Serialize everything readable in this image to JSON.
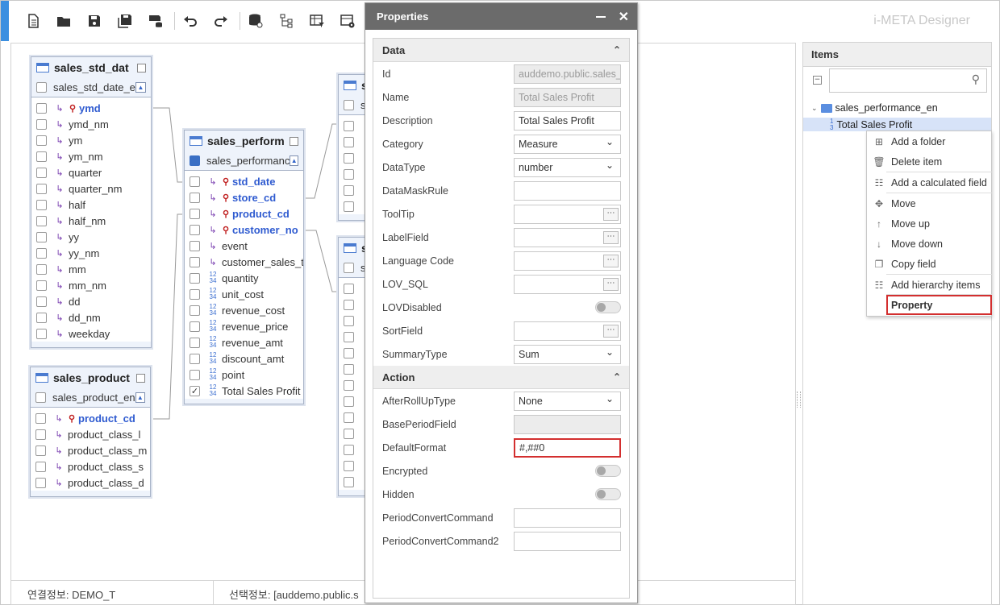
{
  "app_title": "i-META Designer",
  "toolbar_icons": [
    "new-document-icon",
    "open-folder-icon",
    "save-icon",
    "save-all-icon",
    "save-db-icon",
    "undo-icon",
    "redo-icon",
    "database-link-icon",
    "hierarchy-icon",
    "table-filter-icon",
    "table-settings-icon"
  ],
  "tables": {
    "t1": {
      "title": "sales_std_dat",
      "subtitle": "sales_std_date_e",
      "rows": [
        "ymd",
        "ymd_nm",
        "ym",
        "ym_nm",
        "quarter",
        "quarter_nm",
        "half",
        "half_nm",
        "yy",
        "yy_nm",
        "mm",
        "mm_nm",
        "dd",
        "dd_nm",
        "weekday"
      ]
    },
    "t2": {
      "title": "sales_product",
      "subtitle": "sales_product_en",
      "rows": [
        "product_cd",
        "product_class_l",
        "product_class_m",
        "product_class_s",
        "product_class_d"
      ]
    },
    "t3": {
      "title": "sales_perform",
      "subtitle": "sales_performanc",
      "rows": [
        "std_date",
        "store_cd",
        "product_cd",
        "customer_no",
        "event",
        "customer_sales_ti",
        "quantity",
        "unit_cost",
        "revenue_cost",
        "revenue_price",
        "revenue_amt",
        "discount_amt",
        "point",
        "Total Sales Profit"
      ]
    },
    "t4": {
      "title": "s",
      "subtitle": "s"
    },
    "t5": {
      "title": "s",
      "subtitle": "s"
    }
  },
  "status": {
    "conn": "연결정보: DEMO_T",
    "sel": "선택정보: [auddemo.public.s"
  },
  "props": {
    "title": "Properties",
    "data_section": "Data",
    "action_section": "Action",
    "data_rows": [
      {
        "label": "Id",
        "value": "auddemo.public.sales_",
        "kind": "disabled"
      },
      {
        "label": "Name",
        "value": "Total Sales Profit",
        "kind": "disabled"
      },
      {
        "label": "Description",
        "value": "Total Sales Profit",
        "kind": "text"
      },
      {
        "label": "Category",
        "value": "Measure",
        "kind": "select"
      },
      {
        "label": "DataType",
        "value": "number",
        "kind": "select"
      },
      {
        "label": "DataMaskRule",
        "value": "",
        "kind": "text"
      },
      {
        "label": "ToolTip",
        "value": "",
        "kind": "dots"
      },
      {
        "label": "LabelField",
        "value": "",
        "kind": "dots"
      },
      {
        "label": "Language Code",
        "value": "",
        "kind": "dots"
      },
      {
        "label": "LOV_SQL",
        "value": "",
        "kind": "dots"
      },
      {
        "label": "LOVDisabled",
        "value": "",
        "kind": "toggle"
      },
      {
        "label": "SortField",
        "value": "",
        "kind": "dots"
      },
      {
        "label": "SummaryType",
        "value": "Sum",
        "kind": "select"
      }
    ],
    "action_rows": [
      {
        "label": "AfterRollUpType",
        "value": "None",
        "kind": "select"
      },
      {
        "label": "BasePeriodField",
        "value": "",
        "kind": "disabled"
      },
      {
        "label": "DefaultFormat",
        "value": "#,##0",
        "kind": "highlight"
      },
      {
        "label": "Encrypted",
        "value": "",
        "kind": "toggle"
      },
      {
        "label": "Hidden",
        "value": "",
        "kind": "toggle"
      },
      {
        "label": "PeriodConvertCommand",
        "value": "",
        "kind": "text"
      },
      {
        "label": "PeriodConvertCommand2",
        "value": "",
        "kind": "text"
      }
    ]
  },
  "items": {
    "title": "Items",
    "search_value": "",
    "tree_root": "sales_performance_en",
    "tree_child": "Total Sales Profit"
  },
  "context_menu": [
    "Add a folder",
    "Delete item",
    "Add a calculated field",
    "Move",
    "Move up",
    "Move down",
    "Copy field",
    "Add hierarchy items",
    "Property"
  ]
}
